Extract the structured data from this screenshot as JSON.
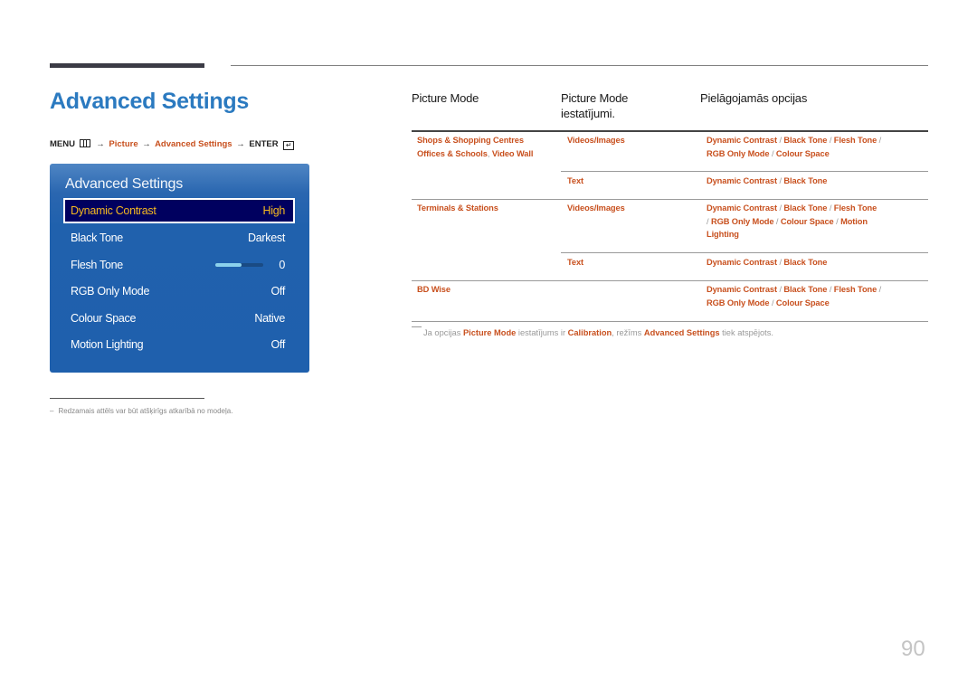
{
  "page": {
    "title": "Advanced Settings",
    "page_number": "90"
  },
  "breadcrumb": {
    "menu": "MENU",
    "menu_icon": "menu-icon",
    "arrow": "→",
    "picture": "Picture",
    "advanced": "Advanced Settings",
    "enter": "ENTER",
    "enter_icon": "enter-icon",
    "enter_glyph": "↵"
  },
  "osd": {
    "title": "Advanced Settings",
    "items": [
      {
        "label": "Dynamic Contrast",
        "value": "High",
        "selected": true
      },
      {
        "label": "Black Tone",
        "value": "Darkest"
      },
      {
        "label": "Flesh Tone",
        "value": "0",
        "slider_fraction": 0.55
      },
      {
        "label": "RGB Only Mode",
        "value": "Off"
      },
      {
        "label": "Colour Space",
        "value": "Native"
      },
      {
        "label": "Motion Lighting",
        "value": "Off"
      }
    ],
    "colors": {
      "panel": "#1f60ad",
      "selected_bg": "#00005f",
      "selected_text": "#f4b820"
    }
  },
  "footnote": {
    "dash": "–",
    "text": "Redzamais attēls var būt atšķirīgs atkarībā no modeļa."
  },
  "table": {
    "headers": [
      "Picture Mode",
      "Picture Mode iestatījumi.",
      "Pielāgojamās opcijas"
    ],
    "rows": [
      {
        "mode_lines": [
          "Shops & Shopping Centres",
          "Offices & Schools",
          ", ",
          "Video Wall"
        ],
        "setting": "Videos/Images",
        "options_lines": [
          [
            "Dynamic Contrast",
            " / ",
            "Black Tone",
            " / ",
            "Flesh Tone",
            " /"
          ],
          [
            "RGB Only Mode",
            " / ",
            "Colour Space"
          ]
        ]
      },
      {
        "mode_lines": [],
        "setting": "Text",
        "options_lines": [
          [
            "Dynamic Contrast",
            " / ",
            "Black Tone"
          ]
        ]
      },
      {
        "mode_lines": [
          "Terminals & Stations"
        ],
        "setting": "Videos/Images",
        "options_lines": [
          [
            "Dynamic Contrast",
            " / ",
            "Black Tone",
            " / ",
            "Flesh Tone"
          ],
          [
            "/ ",
            "RGB Only Mode",
            " / ",
            "Colour Space",
            " / ",
            "Motion"
          ],
          [
            "Lighting"
          ]
        ]
      },
      {
        "mode_lines": [],
        "setting": "Text",
        "options_lines": [
          [
            "Dynamic Contrast",
            " / ",
            "Black Tone"
          ]
        ]
      },
      {
        "mode_lines": [
          "BD Wise"
        ],
        "setting": "",
        "options_lines": [
          [
            "Dynamic Contrast",
            " / ",
            "Black Tone",
            " / ",
            "Flesh Tone",
            " /"
          ],
          [
            "RGB Only Mode",
            " / ",
            "Colour Space"
          ]
        ]
      }
    ]
  },
  "note": {
    "p1": "Ja opcijas ",
    "hl1": "Picture Mode",
    "p2": " iestatījums ir ",
    "hl2": "Calibration",
    "p3": ", režīms ",
    "hl3": "Advanced Settings",
    "p4": " tiek atspējots."
  },
  "colors": {
    "accent_title": "#2b7ac0",
    "link": "#c8501e",
    "muted": "#999999"
  }
}
